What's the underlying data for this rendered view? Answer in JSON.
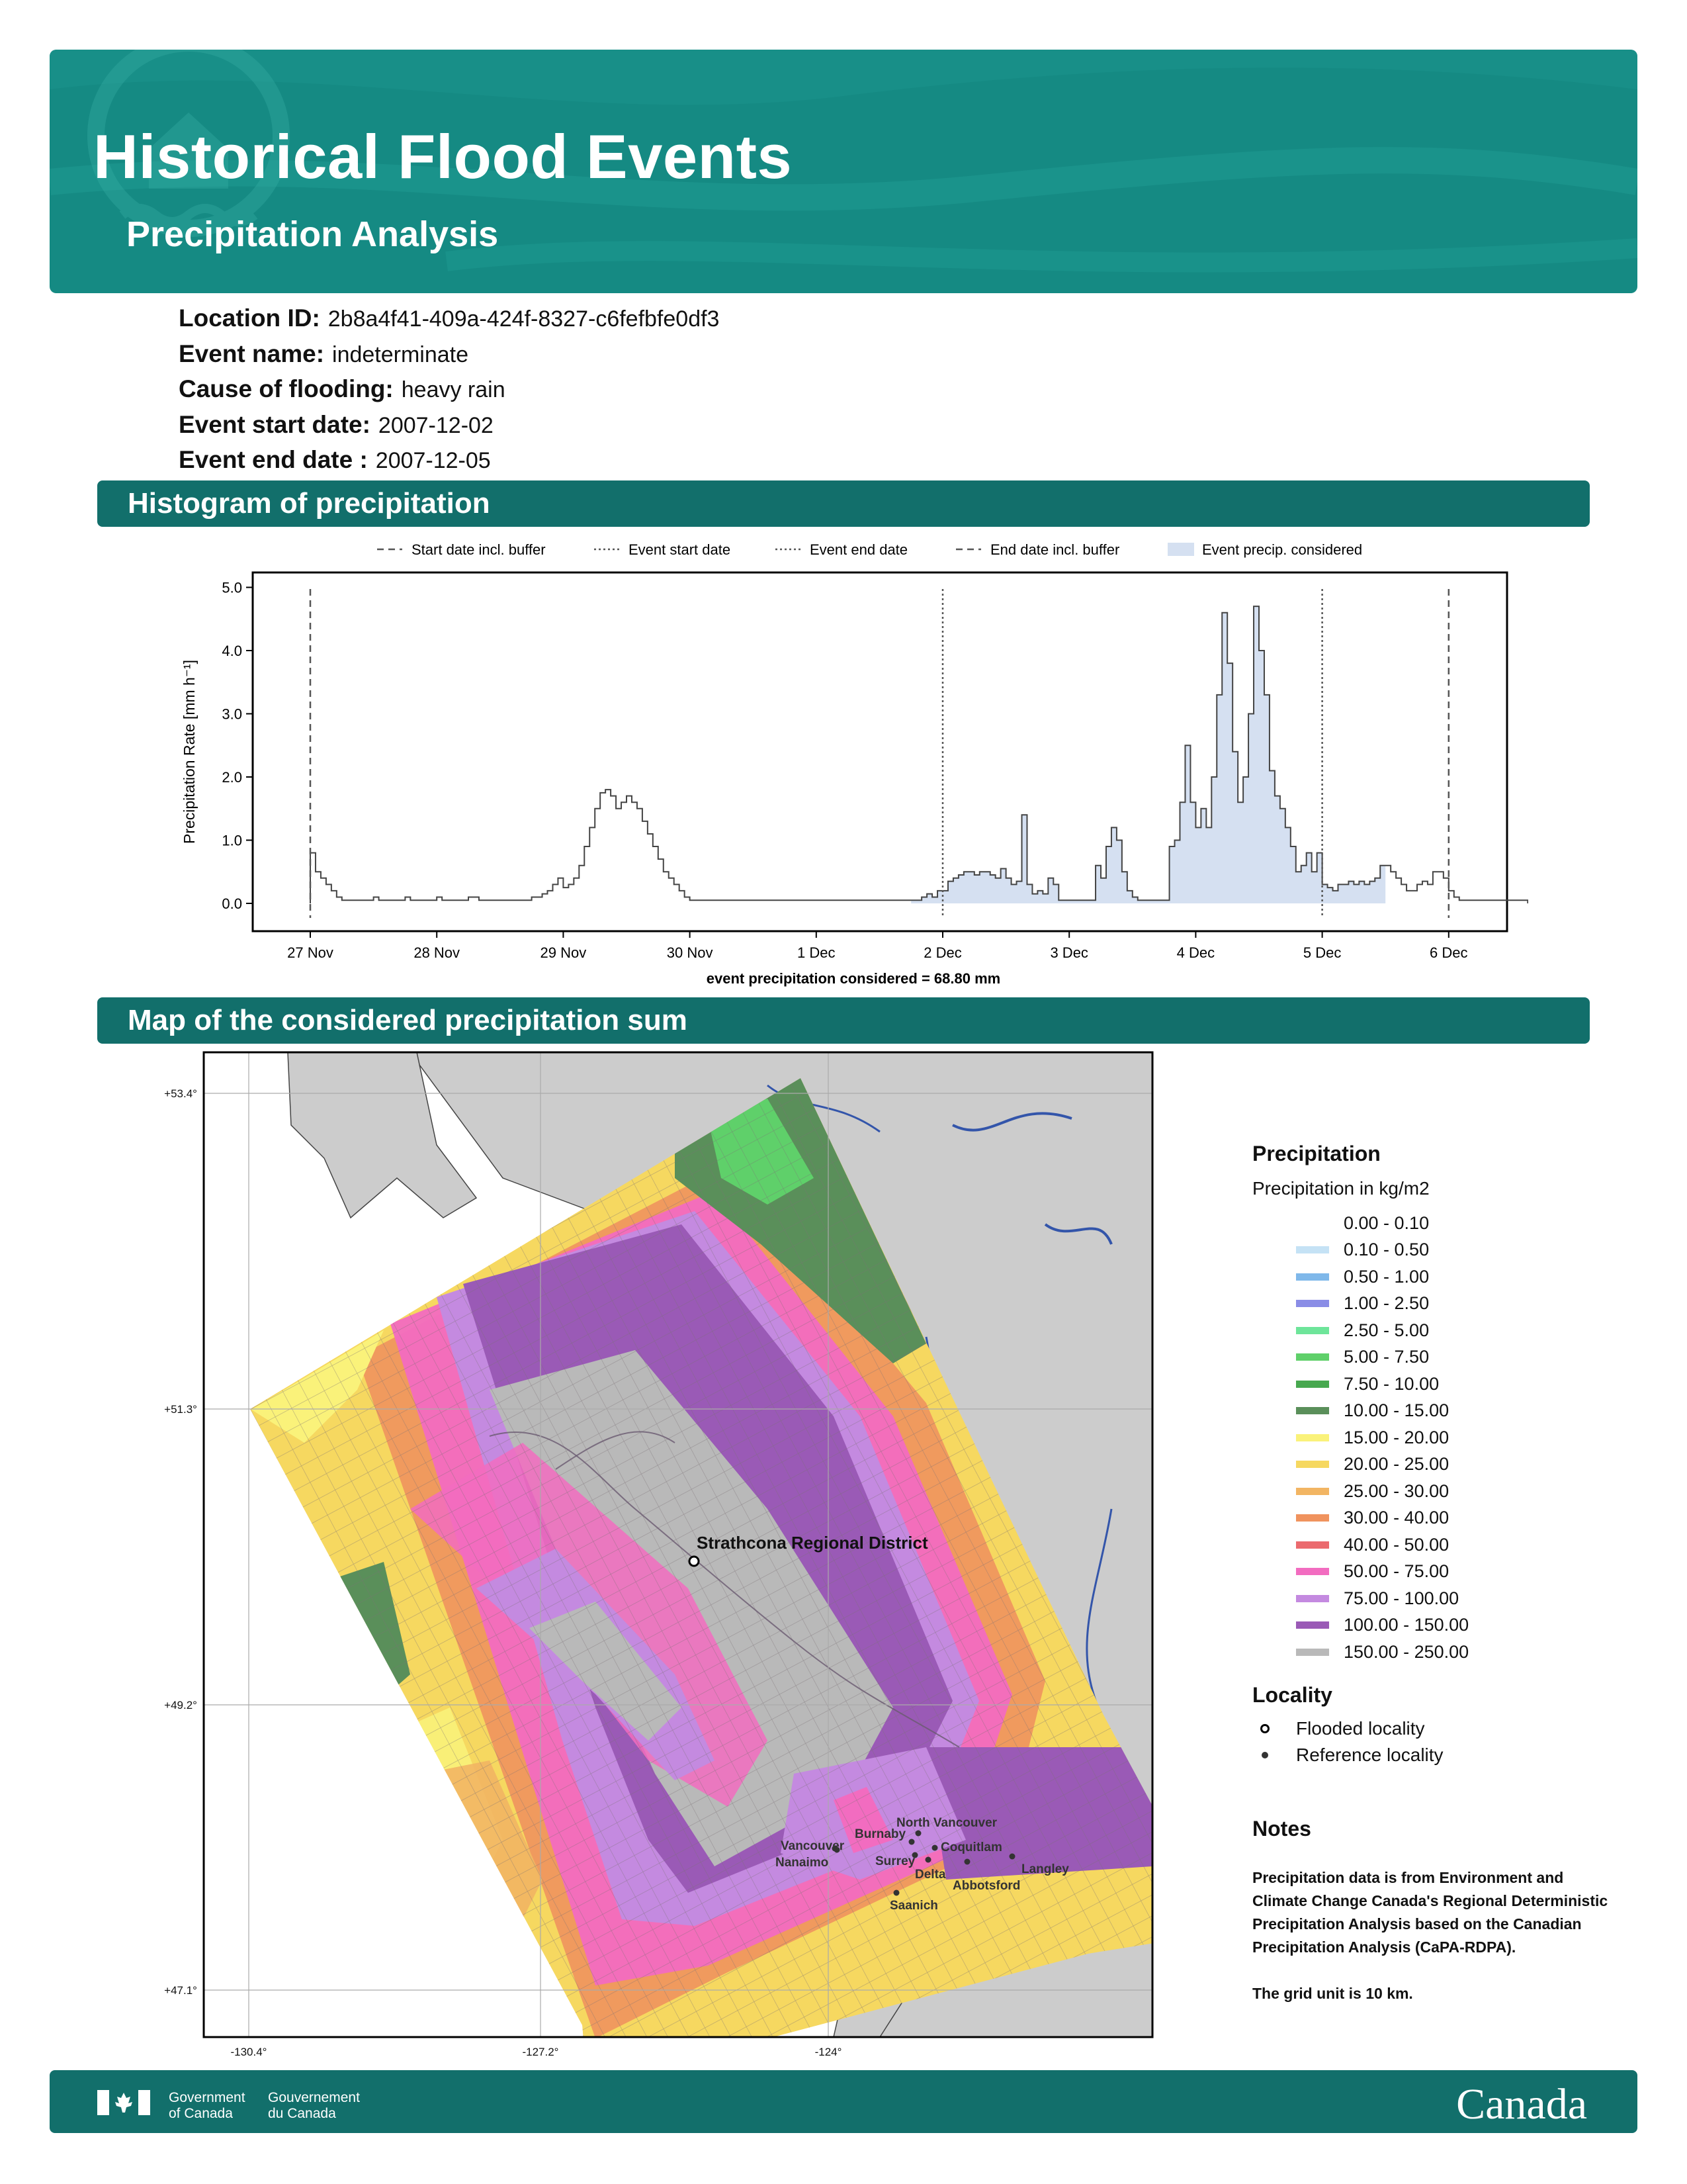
{
  "header": {
    "title": "Historical Flood Events",
    "subtitle": "Precipitation Analysis"
  },
  "event": {
    "location_id_label": "Location ID:",
    "location_id": "2b8a4f41-409a-424f-8327-c6fefbfe0df3",
    "event_name_label": "Event name:",
    "event_name": "indeterminate",
    "cause_label": "Cause of flooding:",
    "cause": "heavy rain",
    "start_label": "Event start date:",
    "start": "2007-12-02",
    "end_label": "Event end date :",
    "end": "2007-12-05"
  },
  "sections": {
    "histogram": "Histogram of precipitation",
    "map": "Map of the considered precipitation sum"
  },
  "chart_data": {
    "type": "area",
    "legend": [
      "Start date incl. buffer",
      "Event start date",
      "Event end date",
      "End date incl. buffer",
      "Event precip. considered"
    ],
    "ylabel": "Precipitation Rate [mm h⁻¹]",
    "ylim": [
      0,
      5
    ],
    "yticks": [
      "0.0",
      "1.0",
      "2.0",
      "3.0",
      "4.0",
      "5.0"
    ],
    "xticks": [
      "27 Nov",
      "28 Nov",
      "29 Nov",
      "30 Nov",
      "1 Dec",
      "2 Dec",
      "3 Dec",
      "4 Dec",
      "5 Dec",
      "6 Dec"
    ],
    "xlabel_note": "event precipitation considered = 68.80 mm",
    "markers": {
      "buffer_start": "2007-11-27T00:00",
      "event_start": "2007-12-02T00:00",
      "event_end": "2007-12-05T00:00",
      "buffer_end": "2007-12-06T00:00"
    },
    "series": [
      {
        "start": "2007-11-27T00:00",
        "step_hours": 1,
        "values": [
          0.8,
          0.5,
          0.4,
          0.3,
          0.2,
          0.1,
          0.05,
          0.05,
          0.05,
          0.05,
          0.05,
          0.05,
          0.1,
          0.05,
          0.05,
          0.05,
          0.05,
          0.05,
          0.1,
          0.05,
          0.05,
          0.05,
          0.05,
          0.05,
          0.1,
          0.05,
          0.05,
          0.05,
          0.05,
          0.05,
          0.1,
          0.1,
          0.05,
          0.05,
          0.05,
          0.05,
          0.05,
          0.05,
          0.05,
          0.05,
          0.05,
          0.05,
          0.1,
          0.1,
          0.15,
          0.2,
          0.3,
          0.4,
          0.25,
          0.3,
          0.4,
          0.6,
          0.9,
          1.2,
          1.5,
          1.75,
          1.8,
          1.7,
          1.5,
          1.6,
          1.7,
          1.6,
          1.5,
          1.3,
          1.1,
          0.9,
          0.7,
          0.5,
          0.4,
          0.3,
          0.2,
          0.1,
          0.05,
          0.05,
          0.05,
          0.05,
          0.05,
          0.05,
          0.05,
          0.05,
          0.05,
          0.05,
          0.05,
          0.05,
          0.05,
          0.05,
          0.05,
          0.05,
          0.05,
          0.05,
          0.05,
          0.05,
          0.05,
          0.05,
          0.05,
          0.05,
          0.05,
          0.05,
          0.05,
          0.05,
          0.05,
          0.05,
          0.05,
          0.05,
          0.05,
          0.05,
          0.05,
          0.05,
          0.05,
          0.05,
          0.05,
          0.05,
          0.05,
          0.05,
          0.05,
          0.05,
          0.1,
          0.15,
          0.1,
          0.2,
          0.2,
          0.35,
          0.4,
          0.45,
          0.5,
          0.5,
          0.45,
          0.5,
          0.5,
          0.45,
          0.4,
          0.55,
          0.4,
          0.3,
          0.35,
          1.4,
          0.3,
          0.15,
          0.2,
          0.15,
          0.4,
          0.3,
          0.05,
          0.05,
          0.05,
          0.05,
          0.05,
          0.05,
          0.05,
          0.6,
          0.4,
          0.9,
          1.2,
          1.0,
          0.5,
          0.2,
          0.1,
          0.05,
          0.05,
          0.05,
          0.05,
          0.05,
          0.05,
          0.9,
          1.0,
          1.6,
          2.5,
          1.6,
          1.2,
          1.5,
          1.2,
          2.0,
          3.3,
          4.6,
          3.8,
          2.4,
          1.6,
          2.0,
          3.0,
          4.7,
          4.0,
          3.3,
          2.1,
          1.7,
          1.5,
          1.2,
          0.9,
          0.5,
          0.6,
          0.8,
          0.5,
          0.8,
          0.3,
          0.25,
          0.2,
          0.3,
          0.3,
          0.35,
          0.3,
          0.35,
          0.3,
          0.35,
          0.4,
          0.6,
          0.6,
          0.5,
          0.4,
          0.3,
          0.2,
          0.2,
          0.3,
          0.35,
          0.3,
          0.5,
          0.5,
          0.4,
          0.2,
          0.1,
          0.05,
          0.05,
          0.05,
          0.05,
          0.05,
          0.05,
          0.05,
          0.05,
          0.05,
          0.05,
          0.05,
          0.05,
          0.05
        ]
      }
    ]
  },
  "map": {
    "lat_ticks": [
      "+53.4°",
      "+51.3°",
      "+49.2°",
      "+47.1°"
    ],
    "lon_ticks": [
      "-130.4°",
      "-127.2°",
      "-124°"
    ],
    "flooded_label": "Strathcona Regional District",
    "localities": [
      {
        "name": "North Vancouver"
      },
      {
        "name": "Burnaby"
      },
      {
        "name": "Vancouver"
      },
      {
        "name": "Coquitlam"
      },
      {
        "name": "Surrey"
      },
      {
        "name": "Nanaimo"
      },
      {
        "name": "Delta"
      },
      {
        "name": "Langley"
      },
      {
        "name": "Abbotsford"
      },
      {
        "name": "Saanich"
      }
    ]
  },
  "legend": {
    "title": "Precipitation",
    "subtitle": "Precipitation in kg/m2",
    "classes": [
      {
        "label": "0.00 - 0.10",
        "color": "#ffffff"
      },
      {
        "label": "0.10 - 0.50",
        "color": "#c5e2f5"
      },
      {
        "label": "0.50 - 1.00",
        "color": "#7fb8ea"
      },
      {
        "label": "1.00 - 2.50",
        "color": "#8a8de6"
      },
      {
        "label": "2.50 - 5.00",
        "color": "#6ee59a"
      },
      {
        "label": "5.00 - 7.50",
        "color": "#5fd06a"
      },
      {
        "label": "7.50 - 10.00",
        "color": "#47a84f"
      },
      {
        "label": "10.00 - 15.00",
        "color": "#5a8f5a"
      },
      {
        "label": "15.00 - 20.00",
        "color": "#faf27a"
      },
      {
        "label": "20.00 - 25.00",
        "color": "#f6d860"
      },
      {
        "label": "25.00 - 30.00",
        "color": "#f2b563"
      },
      {
        "label": "30.00 - 40.00",
        "color": "#f0935e"
      },
      {
        "label": "40.00 - 50.00",
        "color": "#eb6a6e"
      },
      {
        "label": "50.00 - 75.00",
        "color": "#f26cc0"
      },
      {
        "label": "75.00 - 100.00",
        "color": "#c48ae0"
      },
      {
        "label": "100.00 - 150.00",
        "color": "#9a5ab6"
      },
      {
        "label": "150.00 - 250.00",
        "color": "#b9b9b9"
      }
    ],
    "locality_title": "Locality",
    "flooded": "Flooded locality",
    "reference": "Reference locality"
  },
  "notes": {
    "title": "Notes",
    "p1": "Precipitation data is from Environment and Climate Change Canada's Regional Deterministic Precipitation Analysis based on the Canadian Precipitation Analysis (CaPA-RDPA).",
    "p2": "The grid unit is 10 km."
  },
  "footer": {
    "gov_en_1": "Government",
    "gov_en_2": "of Canada",
    "gov_fr_1": "Gouvernement",
    "gov_fr_2": "du Canada",
    "wordmark": "Canada"
  }
}
